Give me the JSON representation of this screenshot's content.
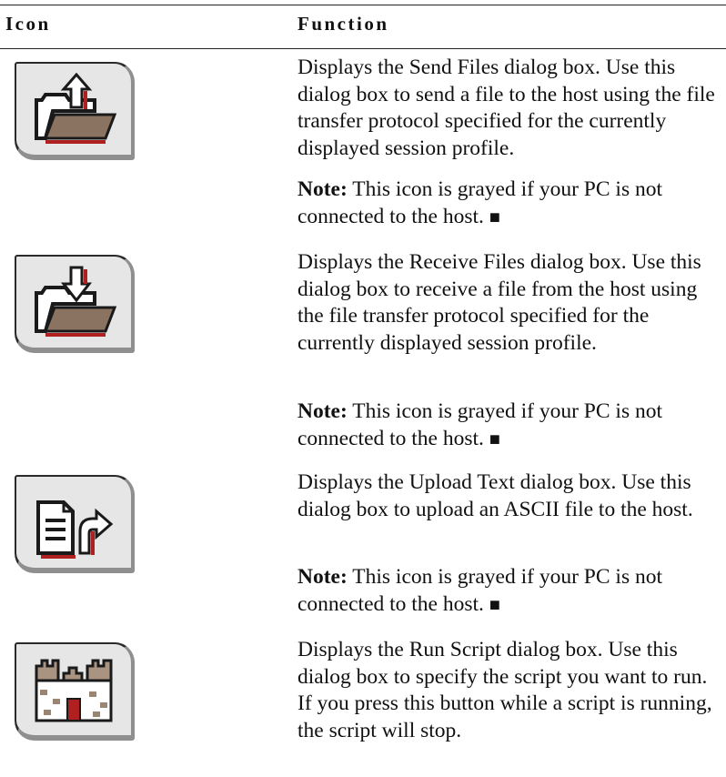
{
  "table": {
    "headers": {
      "icon": "Icon",
      "function": "Function"
    },
    "rows": [
      {
        "icon_name": "send-files-icon",
        "description": "Displays the Send Files dialog box.  Use this dialog box to send a file to the host using the file transfer protocol specified for the currently displayed session profile.",
        "note_label": "Note:",
        "note_text": " This icon is grayed if your PC is not connected to the host. ",
        "end_mark": "■"
      },
      {
        "icon_name": "receive-files-icon",
        "description": "Displays the Receive Files dialog box. Use this dialog box to receive a file from the host using the file transfer protocol specified for the currently displayed session profile.",
        "note_label": "Note:",
        "note_text": " This icon is grayed if your PC is not connected to the host. ",
        "end_mark": "■"
      },
      {
        "icon_name": "upload-text-icon",
        "description": "Displays the Upload Text dialog box.  Use this dialog box to upload an ASCII file to the host.",
        "note_label": "Note:",
        "note_text": " This icon is grayed if your PC is not connected to the host. ",
        "end_mark": "■"
      },
      {
        "icon_name": "run-script-icon",
        "description": "Displays the Run Script dialog box.  Use this dialog box to specify the script you want to run.  If you press this button while a script is running, the script will stop."
      }
    ]
  }
}
